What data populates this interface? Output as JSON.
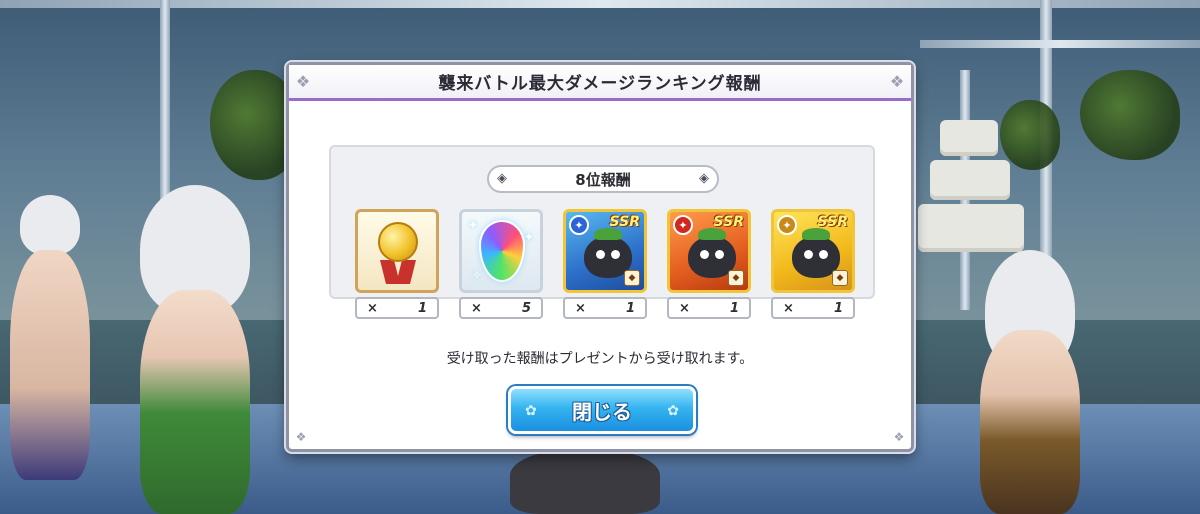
{
  "dialog": {
    "title": "襲来バトル最大ダメージランキング報酬",
    "rank_label": "8位報酬",
    "rewards": [
      {
        "icon": "gold-medal-icon",
        "times": "×",
        "quantity": "1"
      },
      {
        "icon": "rainbow-gem-icon",
        "times": "×",
        "quantity": "5"
      },
      {
        "icon": "ssr-blue-creature-icon",
        "rarity": "SSR",
        "times": "×",
        "quantity": "1"
      },
      {
        "icon": "ssr-red-creature-icon",
        "rarity": "SSR",
        "times": "×",
        "quantity": "1"
      },
      {
        "icon": "ssr-yellow-creature-icon",
        "rarity": "SSR",
        "times": "×",
        "quantity": "1"
      }
    ],
    "note": "受け取った報酬はプレゼントから受け取れます。",
    "close_label": "閉じる"
  },
  "colors": {
    "accent_purple": "#9a6bc8",
    "button_blue": "#35b4f0"
  }
}
